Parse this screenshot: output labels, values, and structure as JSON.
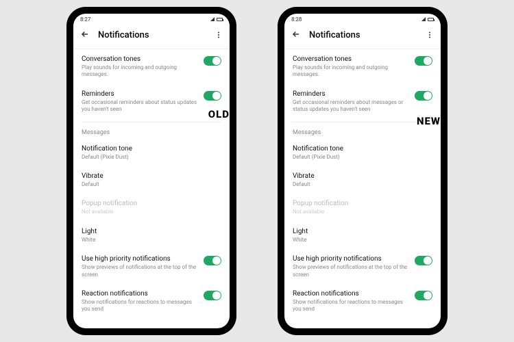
{
  "phones": {
    "left": {
      "time": "8:27",
      "title": "Notifications",
      "convTones": {
        "title": "Conversation tones",
        "sub": "Play sounds for incoming and outgoing messages."
      },
      "reminders": {
        "title": "Reminders",
        "sub": "Get occasional reminders about status updates you haven't seen"
      },
      "badge": "OLD",
      "sectionMessages": "Messages",
      "notifTone": {
        "title": "Notification tone",
        "sub": "Default (Pixie Dust)"
      },
      "vibrate": {
        "title": "Vibrate",
        "sub": "Default"
      },
      "popup": {
        "title": "Popup notification",
        "sub": "Not available"
      },
      "light": {
        "title": "Light",
        "sub": "White"
      },
      "highPriority": {
        "title": "Use high priority notifications",
        "sub": "Show previews of notifications at the top of the screen"
      },
      "reaction": {
        "title": "Reaction notifications",
        "sub": "Show notifications for reactions to messages you send"
      }
    },
    "right": {
      "time": "8:28",
      "title": "Notifications",
      "convTones": {
        "title": "Conversation tones",
        "sub": "Play sounds for incoming and outgoing messages."
      },
      "reminders": {
        "title": "Reminders",
        "sub": "Get occasional reminders about messages or status updates you haven't seen"
      },
      "badge": "NEW",
      "sectionMessages": "Messages",
      "notifTone": {
        "title": "Notification tone",
        "sub": "Default (Pixie Dust)"
      },
      "vibrate": {
        "title": "Vibrate",
        "sub": "Default"
      },
      "popup": {
        "title": "Popup notification",
        "sub": "Not available"
      },
      "light": {
        "title": "Light",
        "sub": "White"
      },
      "highPriority": {
        "title": "Use high priority notifications",
        "sub": "Show previews of notifications at the top of the screen"
      },
      "reaction": {
        "title": "Reaction notifications",
        "sub": "Show notifications for reactions to messages you send"
      }
    }
  }
}
